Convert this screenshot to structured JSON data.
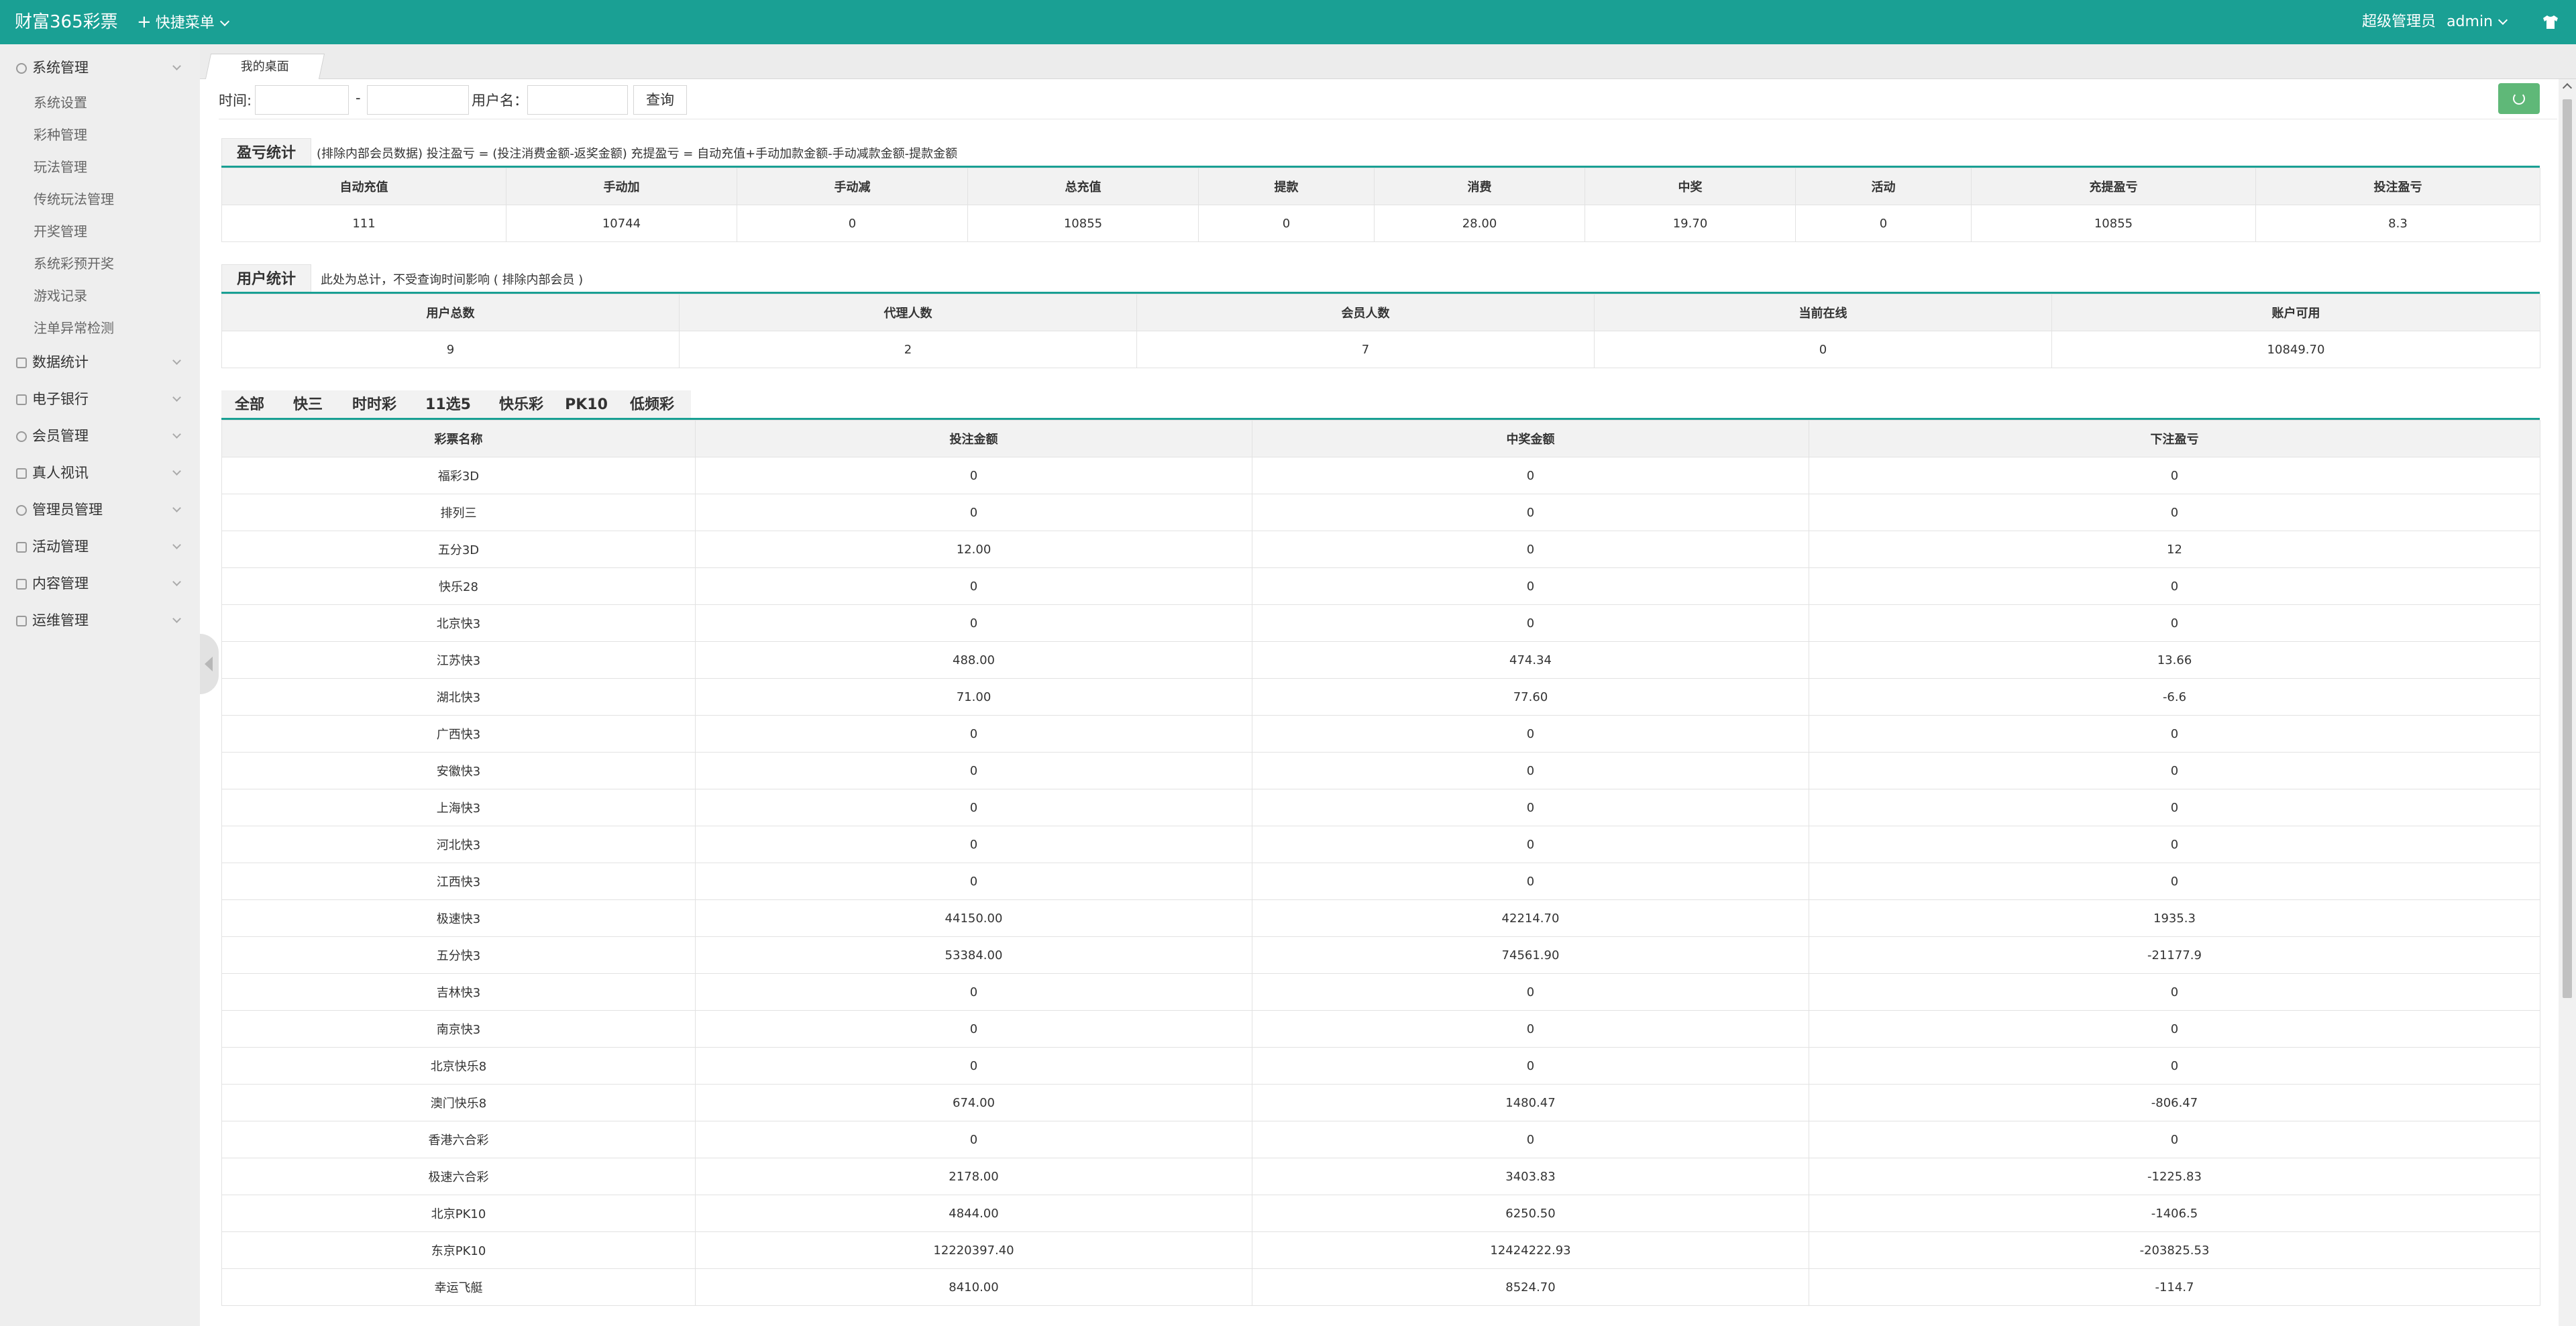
{
  "app": {
    "title": "财富365彩票",
    "quick_menu": "快捷菜单"
  },
  "user": {
    "role": "超级管理员",
    "name": "admin"
  },
  "sidebar": {
    "groups": [
      {
        "label": "系统管理",
        "icon": "gear-icon",
        "expanded": true,
        "items": [
          "系统设置",
          "彩种管理",
          "玩法管理",
          "传统玩法管理",
          "开奖管理",
          "系统彩预开奖",
          "游戏记录",
          "注单异常检测"
        ]
      },
      {
        "label": "数据统计",
        "icon": "chart-icon"
      },
      {
        "label": "电子银行",
        "icon": "list-icon"
      },
      {
        "label": "会员管理",
        "icon": "user-icon"
      },
      {
        "label": "真人视讯",
        "icon": "grid-icon"
      },
      {
        "label": "管理员管理",
        "icon": "person-icon"
      },
      {
        "label": "活动管理",
        "icon": "grid-icon"
      },
      {
        "label": "内容管理",
        "icon": "book-icon"
      },
      {
        "label": "运维管理",
        "icon": "grid-icon"
      }
    ]
  },
  "tabs": {
    "home": "我的桌面"
  },
  "filter": {
    "time_label": "时间:",
    "dash": "-",
    "username_label": "用户名：",
    "query_button": "查询"
  },
  "profit": {
    "title": "盈亏统计",
    "note": "(排除内部会员数据)  投注盈亏 = (投注消费金额-返奖金额)     充提盈亏 = 自动充值+手动加款金额-手动减款金额-提款金额",
    "headers": [
      "自动充值",
      "手动加",
      "手动减",
      "总充值",
      "提款",
      "消费",
      "中奖",
      "活动",
      "充提盈亏",
      "投注盈亏"
    ],
    "values": [
      "111",
      "10744",
      "0",
      "10855",
      "0",
      "28.00",
      "19.70",
      "0",
      "10855",
      "8.3"
    ]
  },
  "users": {
    "title": "用户统计",
    "note": "此处为总计，不受查询时间影响 ( 排除内部会员 )",
    "headers": [
      "用户总数",
      "代理人数",
      "会员人数",
      "当前在线",
      "账户可用"
    ],
    "values": [
      "9",
      "2",
      "7",
      "0",
      "10849.70"
    ]
  },
  "lottery_tabs": [
    "全部",
    "快三",
    "时时彩",
    "11选5",
    "快乐彩",
    "PK10",
    "低频彩"
  ],
  "lottery": {
    "headers": [
      "彩票名称",
      "投注金额",
      "中奖金额",
      "下注盈亏"
    ],
    "rows": [
      [
        "福彩3D",
        "0",
        "0",
        "0"
      ],
      [
        "排列三",
        "0",
        "0",
        "0"
      ],
      [
        "五分3D",
        "12.00",
        "0",
        "12"
      ],
      [
        "快乐28",
        "0",
        "0",
        "0"
      ],
      [
        "北京快3",
        "0",
        "0",
        "0"
      ],
      [
        "江苏快3",
        "488.00",
        "474.34",
        "13.66"
      ],
      [
        "湖北快3",
        "71.00",
        "77.60",
        "-6.6"
      ],
      [
        "广西快3",
        "0",
        "0",
        "0"
      ],
      [
        "安徽快3",
        "0",
        "0",
        "0"
      ],
      [
        "上海快3",
        "0",
        "0",
        "0"
      ],
      [
        "河北快3",
        "0",
        "0",
        "0"
      ],
      [
        "江西快3",
        "0",
        "0",
        "0"
      ],
      [
        "极速快3",
        "44150.00",
        "42214.70",
        "1935.3"
      ],
      [
        "五分快3",
        "53384.00",
        "74561.90",
        "-21177.9"
      ],
      [
        "吉林快3",
        "0",
        "0",
        "0"
      ],
      [
        "南京快3",
        "0",
        "0",
        "0"
      ],
      [
        "北京快乐8",
        "0",
        "0",
        "0"
      ],
      [
        "澳门快乐8",
        "674.00",
        "1480.47",
        "-806.47"
      ],
      [
        "香港六合彩",
        "0",
        "0",
        "0"
      ],
      [
        "极速六合彩",
        "2178.00",
        "3403.83",
        "-1225.83"
      ],
      [
        "北京PK10",
        "4844.00",
        "6250.50",
        "-1406.5"
      ],
      [
        "东京PK10",
        "12220397.40",
        "12424222.93",
        "-203825.53"
      ],
      [
        "幸运飞艇",
        "8410.00",
        "8524.70",
        "-114.7"
      ]
    ]
  },
  "colors": {
    "brand": "#1aa094",
    "refresh": "#5fb878"
  }
}
